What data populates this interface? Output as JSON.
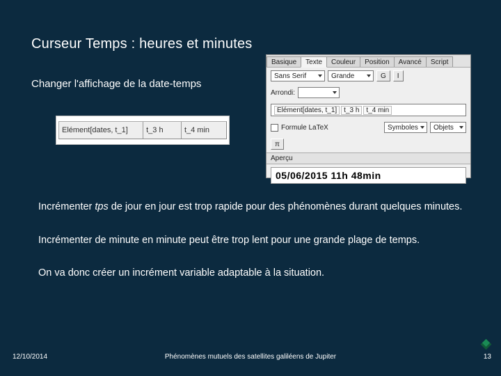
{
  "title": "Curseur Temps : heures et minutes",
  "subtitle": "Changer l'affichage de la date-temps",
  "left_panel": {
    "seg1": "Elément[dates, t_1]",
    "seg2": "t_3 h",
    "seg3": "t_4 min"
  },
  "right_panel": {
    "tabs": [
      "Basique",
      "Texte",
      "Couleur",
      "Position",
      "Avancé",
      "Script"
    ],
    "active_tab": "Texte",
    "font_family": "Sans Serif",
    "font_size": "Grande",
    "bold": "G",
    "italic": "I",
    "arrondi_label": "Arrondi:",
    "expr_seg1": "Elément[dates, t_1]",
    "expr_seg2": "t_3 h",
    "expr_seg3": "t_4 min",
    "latex_label": "Formule LaTeX",
    "symboles_label": "Symboles",
    "objets_label": "Objets",
    "pi": "π",
    "apercu_label": "Aperçu",
    "apercu_value": "05/06/2015  11h 48min"
  },
  "paragraphs": {
    "p1_a": "Incrémenter ",
    "p1_em": "tps",
    "p1_b": " de jour en jour est trop rapide pour des phénomènes durant quelques minutes.",
    "p2": "Incrémenter de minute en minute peut être trop lent pour une grande plage de temps.",
    "p3": "On va donc créer un incrément variable adaptable à la situation."
  },
  "footer": {
    "date": "12/10/2014",
    "title": "Phénomènes mutuels des satellites galiléens de Jupiter",
    "page": "13"
  }
}
